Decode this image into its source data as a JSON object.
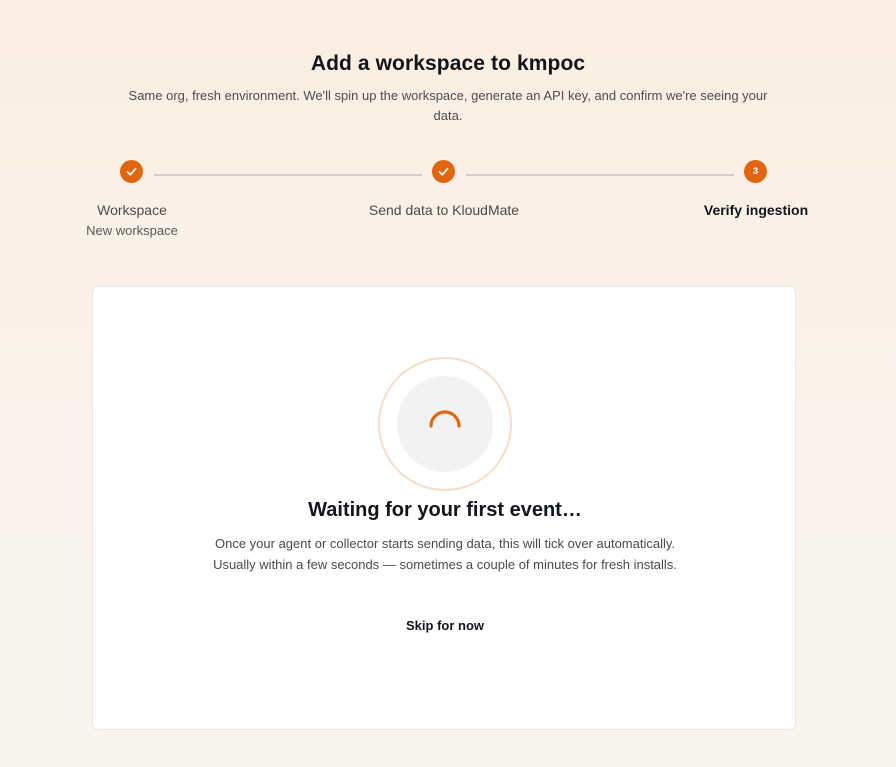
{
  "header": {
    "title": "Add a workspace to kmpoc",
    "subtitle": "Same org, fresh environment. We'll spin up the workspace, generate an API key, and confirm we're seeing your data."
  },
  "stepper": {
    "steps": [
      {
        "label": "Workspace",
        "sublabel": "New workspace",
        "status": "complete",
        "icon": "check-icon"
      },
      {
        "label": "Send data to KloudMate",
        "sublabel": "",
        "status": "complete",
        "icon": "check-icon"
      },
      {
        "label": "Verify ingestion",
        "sublabel": "",
        "status": "active",
        "number": "3"
      }
    ]
  },
  "card": {
    "icon": "spinner-icon",
    "title": "Waiting for your first event…",
    "description_line1": "Once your agent or collector starts sending data, this will tick over automatically.",
    "description_line2": "Usually within a few seconds — sometimes a couple of minutes for fresh installs.",
    "skip_label": "Skip for now"
  },
  "colors": {
    "accent": "#e2660f",
    "ring": "#f7dcc7",
    "line": "#d6cfc8"
  }
}
